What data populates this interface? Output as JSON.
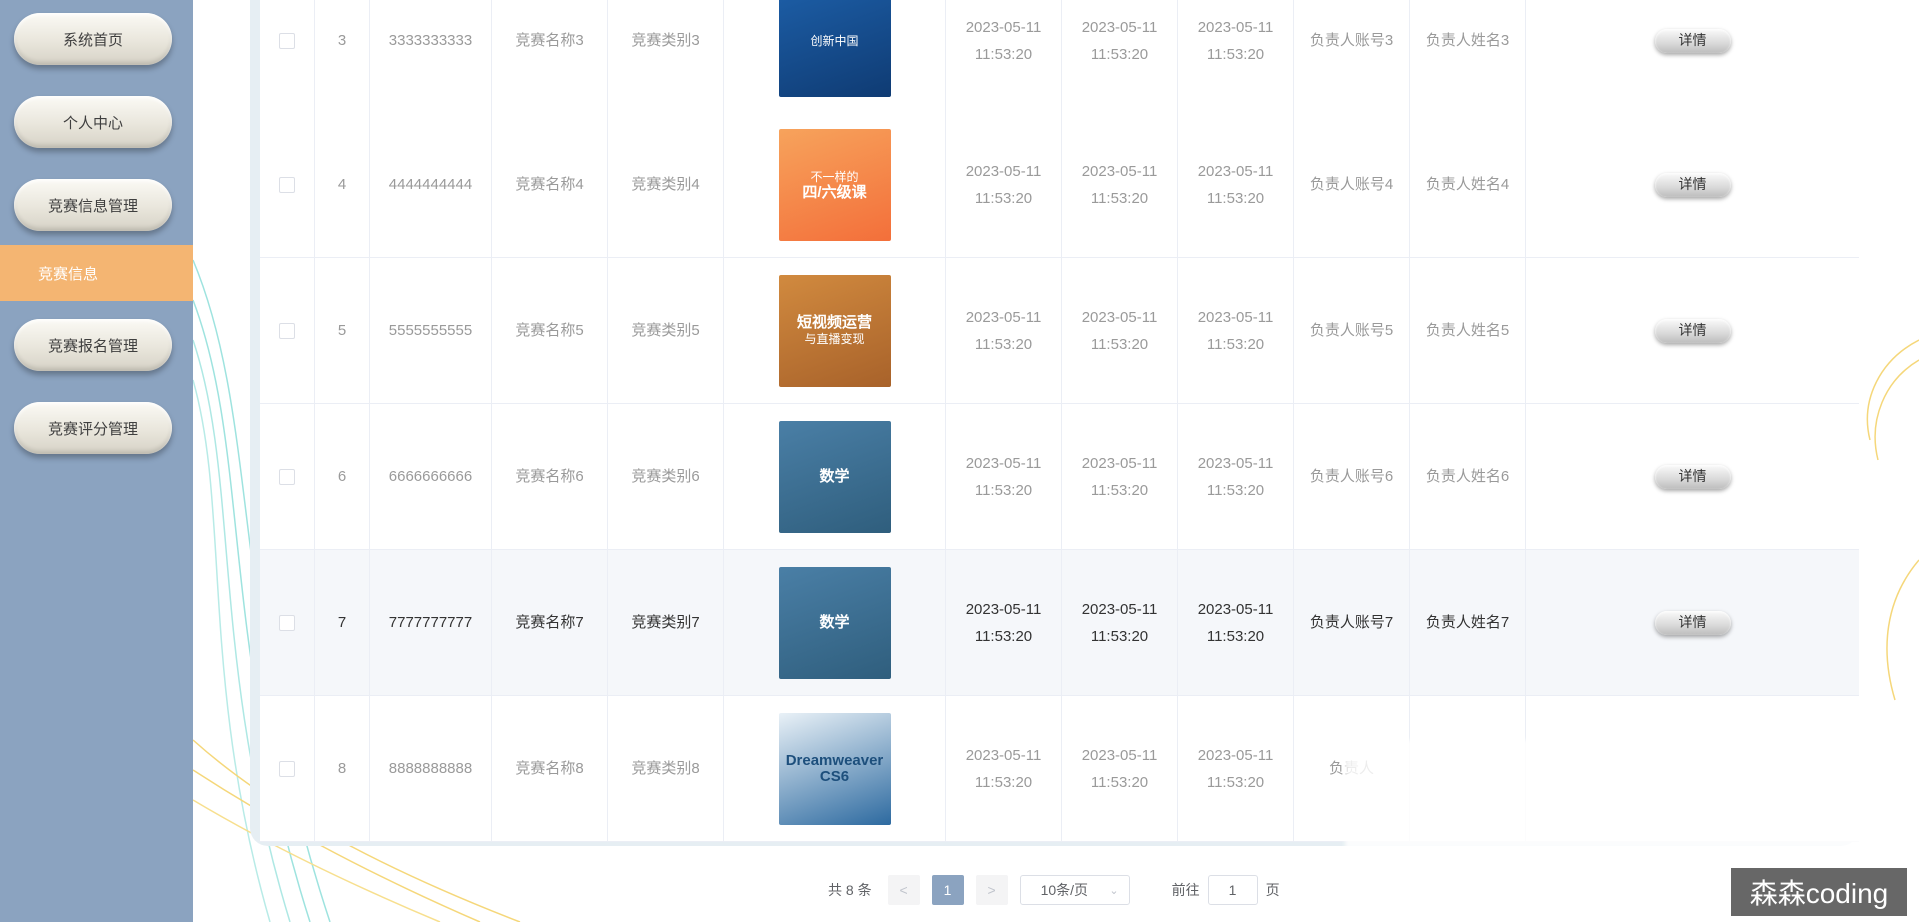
{
  "sidebar": {
    "items": [
      {
        "label": "系统首页"
      },
      {
        "label": "个人中心"
      },
      {
        "label": "竞赛信息管理"
      },
      {
        "label": "竞赛信息"
      },
      {
        "label": "竞赛报名管理"
      },
      {
        "label": "竞赛评分管理"
      }
    ]
  },
  "table": {
    "rows": [
      {
        "index": "3",
        "code": "3333333333",
        "name": "竞赛名称3",
        "category": "竞赛类别3",
        "start": "2023-05-11 11:53:20",
        "end": "2023-05-11 11:53:20",
        "created": "2023-05-11 11:53:20",
        "account": "负责人账号3",
        "owner": "负责人姓名3",
        "action": "详情",
        "cover": {
          "top_text": "创新中国",
          "colors": [
            "#1d5fa8",
            "#0f3b73"
          ]
        }
      },
      {
        "index": "4",
        "code": "4444444444",
        "name": "竞赛名称4",
        "category": "竞赛类别4",
        "start": "2023-05-11 11:53:20",
        "end": "2023-05-11 11:53:20",
        "created": "2023-05-11 11:53:20",
        "account": "负责人账号4",
        "owner": "负责人姓名4",
        "action": "详情",
        "cover": {
          "top_text": "不一样的",
          "main_text": "四/六级课",
          "colors": [
            "#f7a35c",
            "#f36f3a"
          ]
        }
      },
      {
        "index": "5",
        "code": "5555555555",
        "name": "竞赛名称5",
        "category": "竞赛类别5",
        "start": "2023-05-11 11:53:20",
        "end": "2023-05-11 11:53:20",
        "created": "2023-05-11 11:53:20",
        "account": "负责人账号5",
        "owner": "负责人姓名5",
        "action": "详情",
        "cover": {
          "main_text": "短视频运营",
          "sub_text": "与直播变现",
          "colors": [
            "#d18a3f",
            "#a8622a"
          ]
        }
      },
      {
        "index": "6",
        "code": "6666666666",
        "name": "竞赛名称6",
        "category": "竞赛类别6",
        "start": "2023-05-11 11:53:20",
        "end": "2023-05-11 11:53:20",
        "created": "2023-05-11 11:53:20",
        "account": "负责人账号6",
        "owner": "负责人姓名6",
        "action": "详情",
        "cover": {
          "main_text": "数学",
          "colors": [
            "#4a7fa6",
            "#2f5e7d"
          ]
        }
      },
      {
        "index": "7",
        "code": "7777777777",
        "name": "竞赛名称7",
        "category": "竞赛类别7",
        "start": "2023-05-11 11:53:20",
        "end": "2023-05-11 11:53:20",
        "created": "2023-05-11 11:53:20",
        "account": "负责人账号7",
        "owner": "负责人姓名7",
        "action": "详情",
        "cover": {
          "main_text": "数学",
          "colors": [
            "#4a7fa6",
            "#2f5e7d"
          ]
        }
      },
      {
        "index": "8",
        "code": "8888888888",
        "name": "竞赛名称8",
        "category": "竞赛类别8",
        "start": "2023-05-11 11:53:20",
        "end": "2023-05-11 11:53:20",
        "created": "2023-05-11 11:53:20",
        "account": "负责人",
        "owner": "",
        "action": "",
        "cover": {
          "main_text": "Dreamweaver CS6",
          "colors": [
            "#e9f1f7",
            "#2d6aa0"
          ]
        }
      }
    ]
  },
  "pagination": {
    "total": "共 8 条",
    "prev": "<",
    "current_page": "1",
    "next": ">",
    "page_size": "10条/页",
    "goto_label": "前往",
    "goto_value": "1",
    "goto_suffix": "页"
  },
  "watermark": "森森coding",
  "colors": {
    "sidebar": "#8ba3c0",
    "active_menu": "#f4b572",
    "page_current": "#8ba3c0"
  }
}
